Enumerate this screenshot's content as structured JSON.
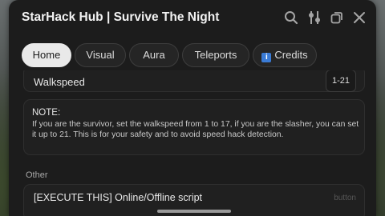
{
  "window": {
    "title": "StarHack Hub | Survive The Night"
  },
  "titlebar_icons": [
    {
      "name": "search-icon"
    },
    {
      "name": "sliders-icon"
    },
    {
      "name": "minimize-icon"
    },
    {
      "name": "close-icon"
    }
  ],
  "tabs": [
    {
      "label": "Home",
      "active": true
    },
    {
      "label": "Visual"
    },
    {
      "label": "Aura"
    },
    {
      "label": "Teleports"
    },
    {
      "label": "Credits",
      "icon": "info-icon"
    }
  ],
  "walkspeed": {
    "label": "Walkspeed",
    "value": "1-21"
  },
  "note": {
    "title": "NOTE:",
    "body": "If you are the survivor, set the walkspeed from 1 to 17, if you are the slasher, you can set it up to 21. This is for your safety and to avoid speed hack detection."
  },
  "other_section": {
    "label": "Other",
    "button_label": "[EXECUTE THIS] Online/Offline script",
    "button_hint": "button"
  },
  "colors": {
    "window_bg": "#1c1c1c",
    "active_tab": "#e9e9e9",
    "info_badge": "#3a7bd5"
  }
}
